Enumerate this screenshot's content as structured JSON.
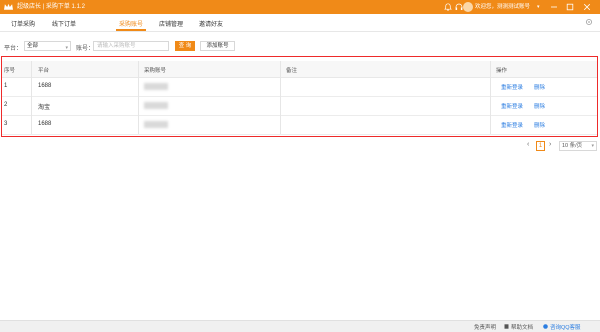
{
  "titlebar": {
    "title": "超级店长 | 采购下单 1.1.2",
    "user": "欢迎您，测测测试账号",
    "icons": [
      "bell-icon",
      "headset-icon",
      "minimize-icon",
      "maximize-icon",
      "close-icon"
    ]
  },
  "tabs": [
    {
      "label": "订单采购"
    },
    {
      "label": "线下订单"
    },
    {
      "label": "采购账号",
      "active": true
    },
    {
      "label": "店铺管理"
    },
    {
      "label": "邀请好友"
    }
  ],
  "filter": {
    "platform_label": "平台：",
    "platform_value": "全部",
    "account_label": "账号：",
    "account_placeholder": "请输入采购账号",
    "query_label": "查 询",
    "add_label": "添加账号"
  },
  "table": {
    "headers": [
      "序号",
      "平台",
      "采购账号",
      "备注",
      "操作"
    ],
    "rows": [
      {
        "index": "1",
        "platform": "1688",
        "account": "",
        "remark": "",
        "relogin": "重新登录",
        "delete": "删除"
      },
      {
        "index": "2",
        "platform": "淘宝",
        "account": "",
        "remark": "",
        "relogin": "重新登录",
        "delete": "删除"
      },
      {
        "index": "3",
        "platform": "1688",
        "account": "",
        "remark": "",
        "relogin": "重新登录",
        "delete": "删除"
      }
    ]
  },
  "pagination": {
    "current": "1",
    "page_size": "10 条/页"
  },
  "footer": {
    "disclaimer": "免责声明",
    "help": "帮助文档",
    "qq": "咨询QQ客服"
  },
  "colors": {
    "brand": "#f08a18",
    "link": "#2b7de1",
    "highlight_frame": "#ee2a2a"
  }
}
